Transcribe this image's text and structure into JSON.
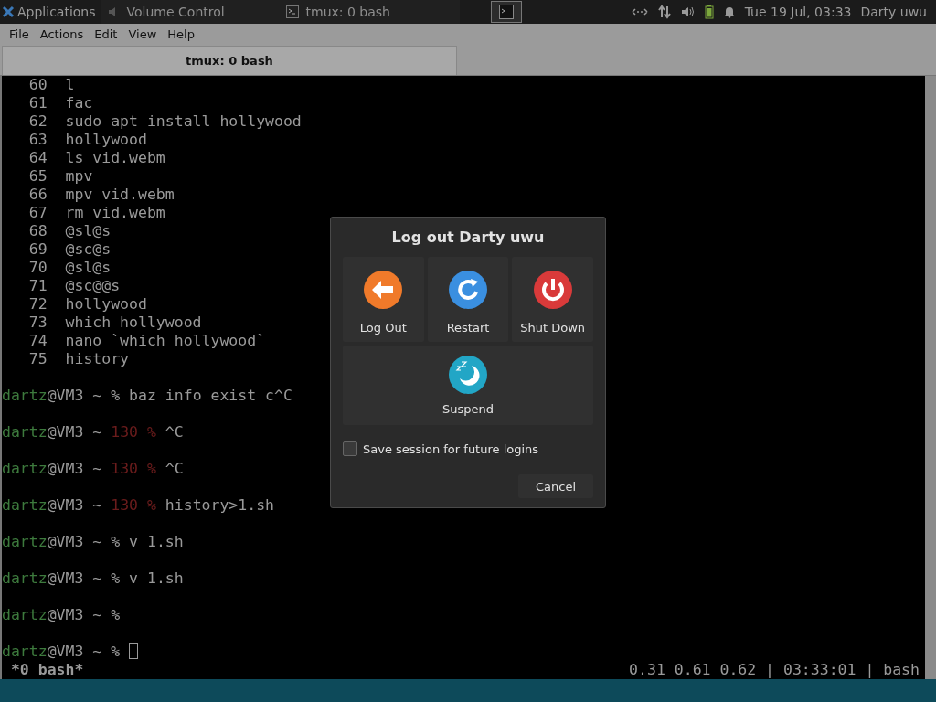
{
  "top_panel": {
    "apps_label": "Applications",
    "tasks": [
      {
        "title": "Volume Control",
        "kind": "sound",
        "selected": false
      },
      {
        "title": "tmux: 0 bash",
        "kind": "terminal",
        "selected": false
      }
    ],
    "workspace_selected": true,
    "clock": "Tue 19 Jul, 03:33",
    "user": "Darty uwu"
  },
  "menubar": [
    "File",
    "Actions",
    "Edit",
    "View",
    "Help"
  ],
  "tabs": [
    {
      "label": "tmux: 0 bash",
      "selected": true
    }
  ],
  "terminal": {
    "history": [
      {
        "number": "60",
        "command": "l"
      },
      {
        "number": "61",
        "command": "fac"
      },
      {
        "number": "62",
        "command": "sudo apt install hollywood"
      },
      {
        "number": "63",
        "command": "hollywood"
      },
      {
        "number": "64",
        "command": "ls vid.webm"
      },
      {
        "number": "65",
        "command": "mpv"
      },
      {
        "number": "66",
        "command": "mpv vid.webm"
      },
      {
        "number": "67",
        "command": "rm vid.webm"
      },
      {
        "number": "68",
        "command": "@sl@s"
      },
      {
        "number": "69",
        "command": "@sc@s"
      },
      {
        "number": "70",
        "command": "@sl@s"
      },
      {
        "number": "71",
        "command": "@sc@@s"
      },
      {
        "number": "72",
        "command": "hollywood"
      },
      {
        "number": "73",
        "command": "which hollywood"
      },
      {
        "number": "74",
        "command": "nano `which hollywood`"
      },
      {
        "number": "75",
        "command": "history"
      }
    ],
    "prompts": [
      {
        "user": "dartz",
        "host": "@VM3 ~",
        "symbol": "%",
        "command": "baz info exist c^C",
        "cursor": false
      },
      {
        "user": "dartz",
        "host": "@VM3 ~",
        "exit_code": "130",
        "symbol": "%",
        "command": "^C",
        "cursor": false
      },
      {
        "user": "dartz",
        "host": "@VM3 ~",
        "exit_code": "130",
        "symbol": "%",
        "command": "^C",
        "cursor": false
      },
      {
        "user": "dartz",
        "host": "@VM3 ~",
        "exit_code": "130",
        "symbol": "%",
        "command": "history>1.sh",
        "cursor": false
      },
      {
        "user": "dartz",
        "host": "@VM3 ~",
        "symbol": "%",
        "command": "v 1.sh",
        "cursor": false
      },
      {
        "user": "dartz",
        "host": "@VM3 ~",
        "symbol": "%",
        "command": "v 1.sh",
        "cursor": false
      },
      {
        "user": "dartz",
        "host": "@VM3 ~",
        "symbol": "%",
        "cursor": false
      },
      {
        "user": "dartz",
        "host": "@VM3 ~",
        "symbol": "%",
        "cursor": true
      }
    ],
    "status_left": "*0 bash*",
    "status_right": "0.31 0.61 0.62 | 03:33:01 | bash"
  },
  "dialog": {
    "title": "Log out Darty uwu",
    "actions": [
      {
        "label": "Log Out",
        "kind": "logout"
      },
      {
        "label": "Restart",
        "kind": "restart"
      },
      {
        "label": "Shut Down",
        "kind": "shutdown"
      },
      {
        "label": "Suspend",
        "kind": "suspend"
      }
    ],
    "save_session": {
      "label": "Save session for future logins",
      "checked": false
    },
    "cancel": "Cancel"
  }
}
